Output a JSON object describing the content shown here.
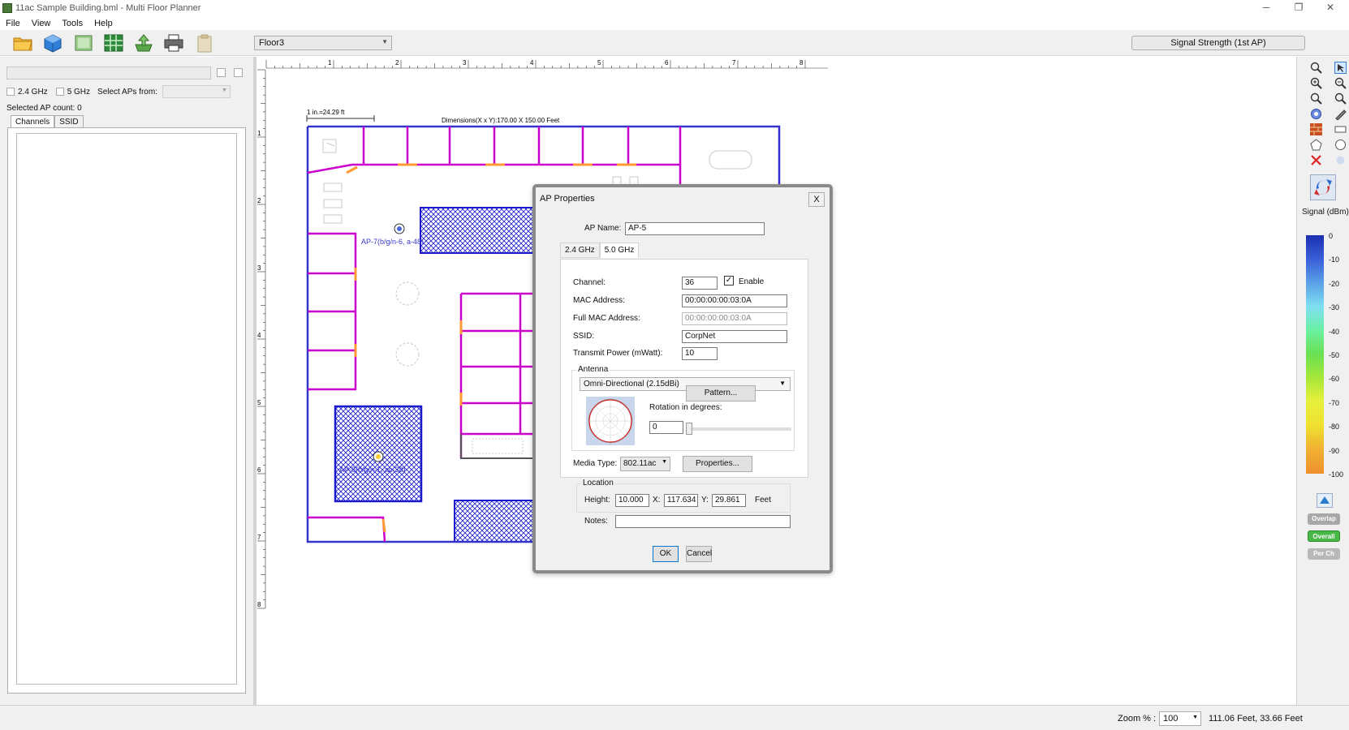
{
  "window": {
    "title": "11ac Sample Building.bml - Multi Floor Planner",
    "minimize_glyph": "─",
    "restore_glyph": "❐",
    "close_glyph": "✕"
  },
  "menu": [
    "File",
    "View",
    "Tools",
    "Help"
  ],
  "toolbar": {
    "floor_select": "Floor3",
    "signal_mode": "Signal Strength (1st AP)",
    "icons": [
      "open-folder-icon",
      "3d-cube-icon",
      "floor-image-icon",
      "grid-icon",
      "export-icon",
      "print-icon",
      "clipboard-icon"
    ]
  },
  "left_panel": {
    "band_24": "2.4 GHz",
    "band_5": "5 GHz",
    "select_aps_label": "Select APs from:",
    "selected_count": "Selected AP count: 0",
    "tabs": [
      "Channels",
      "SSID"
    ]
  },
  "canvas": {
    "ruler_top": [
      "1",
      "2",
      "3",
      "4",
      "5",
      "6",
      "7",
      "8"
    ],
    "ruler_left": [
      "1",
      "2",
      "3",
      "4",
      "5",
      "6",
      "7",
      "8"
    ],
    "scale_text": "1 in.=24.29 ft",
    "dimensions_text": "Dimensions(X x Y):170.00 X 150.00 Feet",
    "ap_labels": [
      {
        "name": "ap-7",
        "text": "AP-7(b/g/n-6, a-48)"
      },
      {
        "name": "ap-8",
        "text": "AP-8(b/g/n-1, ac-38)"
      }
    ]
  },
  "dialog": {
    "title": "AP Properties",
    "close_label": "X",
    "ap_name_label": "AP Name:",
    "ap_name_value": "AP-5",
    "tabs": [
      "2.4 GHz",
      "5.0 GHz"
    ],
    "channel_label": "Channel:",
    "channel_value": "36",
    "enable_label": "Enable",
    "enable_checked": true,
    "mac_label": "MAC Address:",
    "mac_value": "00:00:00:00:03:0A",
    "full_mac_label": "Full MAC Address:",
    "full_mac_value": "00:00:00:00:03:0A",
    "ssid_label": "SSID:",
    "ssid_value": "CorpNet",
    "power_label": "Transmit Power (mWatt):",
    "power_value": "10",
    "antenna_label": "Antenna",
    "antenna_value": "Omni-Directional (2.15dBi)",
    "pattern_button": "Pattern...",
    "rotation_label": "Rotation in degrees:",
    "rotation_value": "0",
    "media_type_label": "Media Type:",
    "media_type_value": "802.11ac",
    "properties_button": "Properties...",
    "location_label": "Location",
    "height_label": "Height:",
    "height_value": "10.000",
    "x_label": "X:",
    "x_value": "117.634",
    "y_label": "Y:",
    "y_value": "29.861",
    "unit_label": "Feet",
    "notes_label": "Notes:",
    "notes_value": "",
    "ok_button": "OK",
    "cancel_button": "Cancel"
  },
  "right_panel": {
    "signal_label": "Signal (dBm)",
    "scale_ticks": [
      "0",
      "-10",
      "-20",
      "-30",
      "-40",
      "-50",
      "-60",
      "-70",
      "-80",
      "-90",
      "-100"
    ],
    "buttons": [
      "Overlap",
      "Overall",
      "Per Ch"
    ]
  },
  "status": {
    "zoom_label": "Zoom % :",
    "zoom_value": "100",
    "coords": "111.06 Feet, 33.66 Feet"
  },
  "colors": {
    "wall": "#cc00cc",
    "outer_wall": "#3333cc",
    "door": "#ff9933",
    "hatched_room": "#1a1acc"
  }
}
